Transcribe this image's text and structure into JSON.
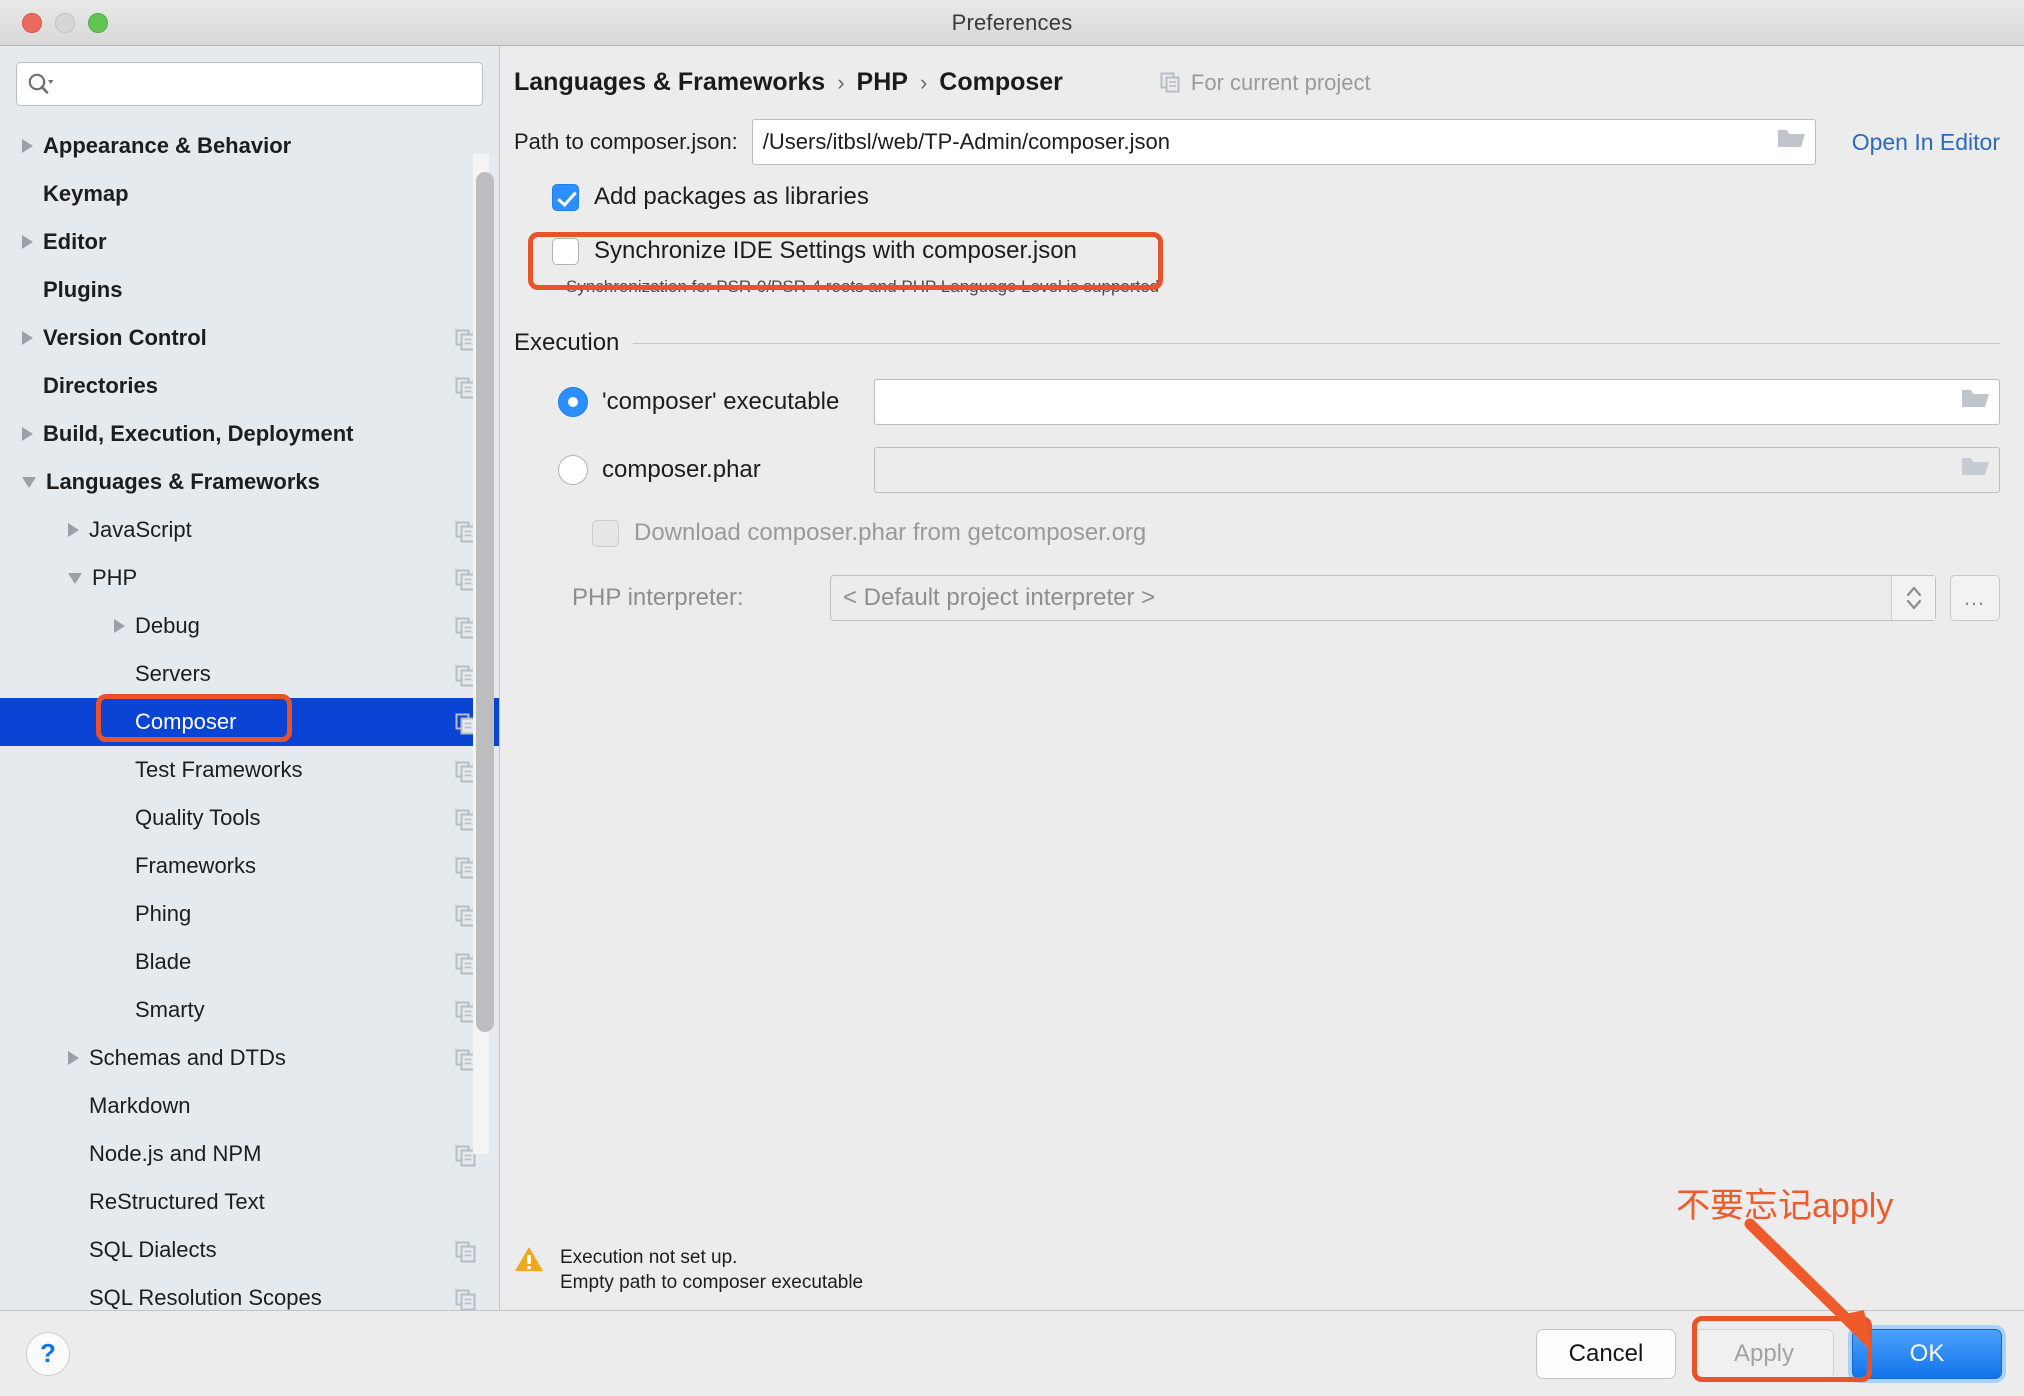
{
  "window": {
    "title": "Preferences",
    "traffic_lights": [
      "close-button",
      "minimize-button",
      "zoom-button"
    ]
  },
  "sidebar": {
    "search": {
      "placeholder": "",
      "value": "",
      "icon": "search-icon"
    },
    "items": [
      {
        "label": "Appearance & Behavior",
        "arrow": "right",
        "indent": 0,
        "bold": true,
        "copy": false,
        "selected": false
      },
      {
        "label": "Keymap",
        "arrow": "none",
        "indent": 0,
        "bold": true,
        "copy": false,
        "selected": false
      },
      {
        "label": "Editor",
        "arrow": "right",
        "indent": 0,
        "bold": true,
        "copy": false,
        "selected": false
      },
      {
        "label": "Plugins",
        "arrow": "none",
        "indent": 0,
        "bold": true,
        "copy": false,
        "selected": false
      },
      {
        "label": "Version Control",
        "arrow": "right",
        "indent": 0,
        "bold": true,
        "copy": true,
        "selected": false
      },
      {
        "label": "Directories",
        "arrow": "none",
        "indent": 0,
        "bold": true,
        "copy": true,
        "selected": false
      },
      {
        "label": "Build, Execution, Deployment",
        "arrow": "right",
        "indent": 0,
        "bold": true,
        "copy": false,
        "selected": false
      },
      {
        "label": "Languages & Frameworks",
        "arrow": "down",
        "indent": 0,
        "bold": true,
        "copy": false,
        "selected": false
      },
      {
        "label": "JavaScript",
        "arrow": "right",
        "indent": 1,
        "bold": false,
        "copy": true,
        "selected": false
      },
      {
        "label": "PHP",
        "arrow": "down",
        "indent": 1,
        "bold": false,
        "copy": true,
        "selected": false
      },
      {
        "label": "Debug",
        "arrow": "right",
        "indent": 2,
        "bold": false,
        "copy": true,
        "selected": false
      },
      {
        "label": "Servers",
        "arrow": "none",
        "indent": 2,
        "bold": false,
        "copy": true,
        "selected": false
      },
      {
        "label": "Composer",
        "arrow": "none",
        "indent": 2,
        "bold": false,
        "copy": true,
        "selected": true
      },
      {
        "label": "Test Frameworks",
        "arrow": "none",
        "indent": 2,
        "bold": false,
        "copy": true,
        "selected": false
      },
      {
        "label": "Quality Tools",
        "arrow": "none",
        "indent": 2,
        "bold": false,
        "copy": true,
        "selected": false
      },
      {
        "label": "Frameworks",
        "arrow": "none",
        "indent": 2,
        "bold": false,
        "copy": true,
        "selected": false
      },
      {
        "label": "Phing",
        "arrow": "none",
        "indent": 2,
        "bold": false,
        "copy": true,
        "selected": false
      },
      {
        "label": "Blade",
        "arrow": "none",
        "indent": 2,
        "bold": false,
        "copy": true,
        "selected": false
      },
      {
        "label": "Smarty",
        "arrow": "none",
        "indent": 2,
        "bold": false,
        "copy": true,
        "selected": false
      },
      {
        "label": "Schemas and DTDs",
        "arrow": "right",
        "indent": 1,
        "bold": false,
        "copy": true,
        "selected": false
      },
      {
        "label": "Markdown",
        "arrow": "none",
        "indent": 1,
        "bold": false,
        "copy": false,
        "selected": false
      },
      {
        "label": "Node.js and NPM",
        "arrow": "none",
        "indent": 1,
        "bold": false,
        "copy": true,
        "selected": false
      },
      {
        "label": "ReStructured Text",
        "arrow": "none",
        "indent": 1,
        "bold": false,
        "copy": false,
        "selected": false
      },
      {
        "label": "SQL Dialects",
        "arrow": "none",
        "indent": 1,
        "bold": false,
        "copy": true,
        "selected": false
      },
      {
        "label": "SQL Resolution Scopes",
        "arrow": "none",
        "indent": 1,
        "bold": false,
        "copy": true,
        "selected": false
      }
    ]
  },
  "content": {
    "breadcrumb": {
      "root": "Languages & Frameworks",
      "sep1": "›",
      "mid": "PHP",
      "sep2": "›",
      "leaf": "Composer"
    },
    "for_project_label": "For current project",
    "path_label": "Path to composer.json:",
    "path_value": "/Users/itbsl/web/TP-Admin/composer.json",
    "open_in_editor_label": "Open In Editor",
    "add_packages_label": "Add packages as libraries",
    "sync_label": "Synchronize IDE Settings with composer.json",
    "hint": "Synchronization for PSR-0/PSR-4 roots and PHP Language Level is supported",
    "execution_label": "Execution",
    "composer_exec_label": "'composer' executable",
    "composer_exec_value": "",
    "composer_phar_label": "composer.phar",
    "composer_phar_value": "",
    "download_label": "Download composer.phar from getcomposer.org",
    "interpreter_label": "PHP interpreter:",
    "interpreter_value": "< Default project interpreter >",
    "ellipsis_label": "…",
    "warning_line1": "Execution not set up.",
    "warning_line2": "Empty path to composer executable"
  },
  "footer": {
    "help_label": "?",
    "cancel_label": "Cancel",
    "apply_label": "Apply",
    "ok_label": "OK"
  },
  "annotations": {
    "note_text": "不要忘记apply",
    "color": "#EF5A2B"
  },
  "colors": {
    "selection_blue": "#0B43D4",
    "link_blue": "#2A6BC0",
    "accent_blue": "#2B8FFF",
    "annotation_orange": "#E8532A",
    "warning_yellow": "#F2A81C",
    "sidebar_bg": "#E4EAEE",
    "content_bg": "#ECECEC"
  }
}
